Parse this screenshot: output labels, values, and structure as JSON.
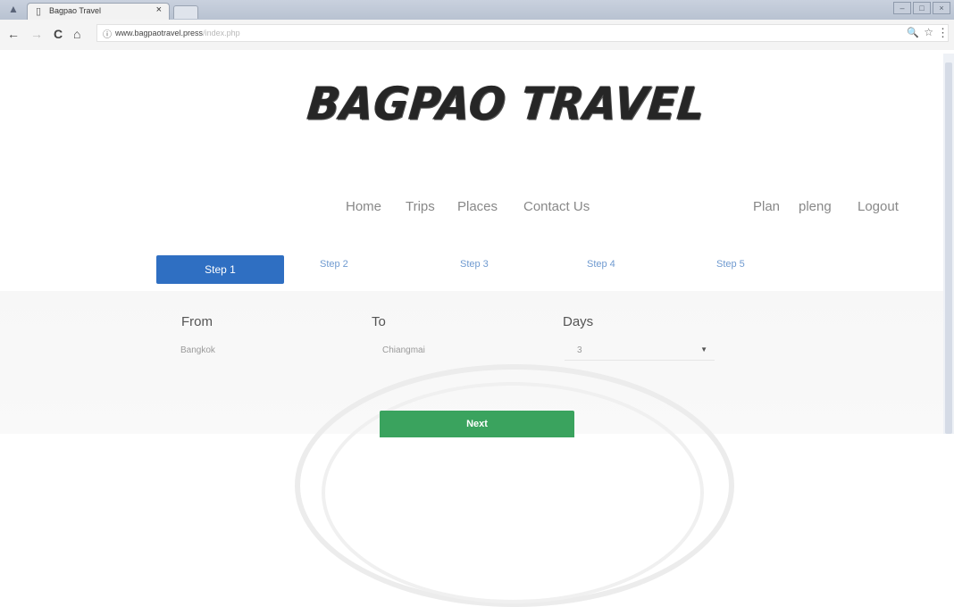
{
  "browser": {
    "tab_title": "Bagpao Travel",
    "tab_close": "×",
    "url": "www.bagpaotravel.press",
    "url_path": "/index.php",
    "window_controls": [
      "–",
      "□",
      "×"
    ]
  },
  "icons": {
    "back": "←",
    "forward": "→",
    "reload": "C",
    "home": "⌂",
    "info": "ⓘ",
    "zoom": "🔍",
    "star": "☆",
    "menu": "⋮"
  },
  "site": {
    "logo_text": "BAGPAO TRAVEL"
  },
  "main_nav": [
    "Home",
    "Trips",
    "Places",
    "Contact Us"
  ],
  "user_nav": [
    "Plan",
    "pleng",
    "Logout"
  ],
  "steps": [
    "Step 1",
    "Step 2",
    "Step 3",
    "Step 4",
    "Step 5"
  ],
  "active_step": "Step 1",
  "form": {
    "from_label": "From",
    "from_value": "Bangkok",
    "to_label": "To",
    "to_value": "Chiangmai",
    "days_label": "Days",
    "days_value": "3",
    "next_label": "Next"
  },
  "colors": {
    "active_step_bg": "#2f6fc2",
    "next_button_bg": "#3aa35e",
    "step_link": "#6f9ad0"
  }
}
